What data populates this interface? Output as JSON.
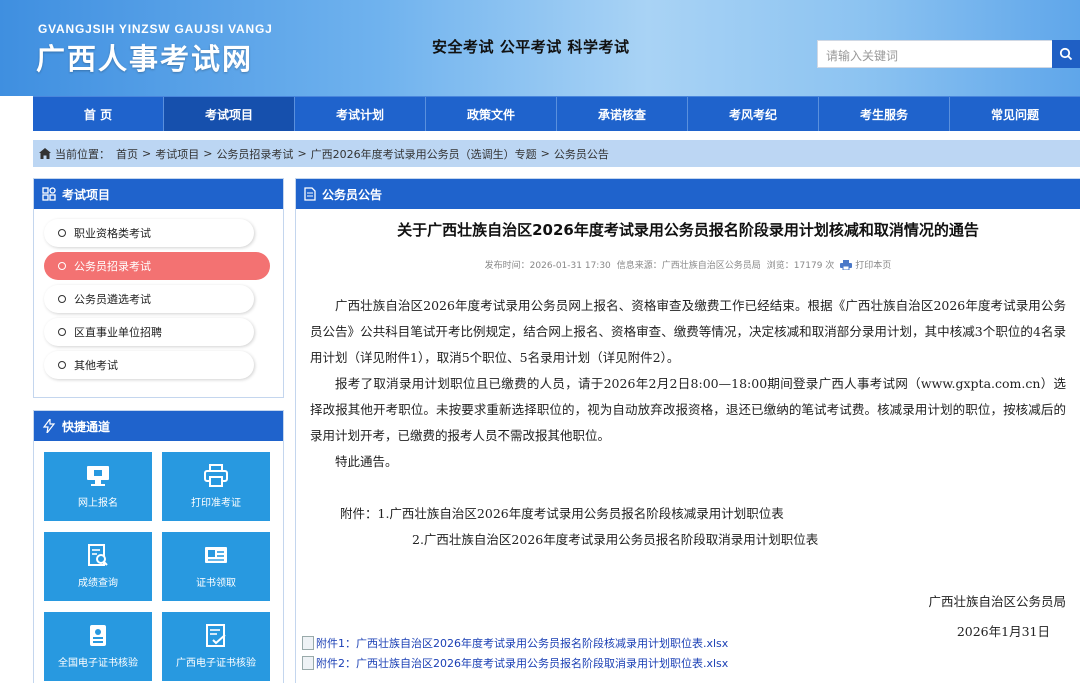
{
  "header": {
    "pinyin": "GVANGJSIH YINZSW GAUJSI VANGJ",
    "site_title": "广西人事考试网",
    "slogan": "安全考试  公平考试  科学考试",
    "search_placeholder": "请输入关键词"
  },
  "nav": {
    "items": [
      "首 页",
      "考试项目",
      "考试计划",
      "政策文件",
      "承诺核查",
      "考风考纪",
      "考生服务",
      "常见问题"
    ],
    "active_index": 1
  },
  "breadcrumb": {
    "prefix": "当前位置：",
    "items": [
      "首页",
      "考试项目",
      "公务员招录考试",
      "广西2026年度考试录用公务员（选调生）专题",
      "公务员公告"
    ],
    "separator": ">"
  },
  "sidebar": {
    "exam_panel_title": "考试项目",
    "exam_items": [
      "职业资格类考试",
      "公务员招录考试",
      "公务员遴选考试",
      "区直事业单位招聘",
      "其他考试"
    ],
    "active_index": 1,
    "quick_panel_title": "快捷通道",
    "quick_links": [
      {
        "label": "网上报名",
        "icon": "computer-icon"
      },
      {
        "label": "打印准考证",
        "icon": "printer-icon"
      },
      {
        "label": "成绩查询",
        "icon": "search-document-icon"
      },
      {
        "label": "证书领取",
        "icon": "certificate-icon"
      },
      {
        "label": "全国电子证书核验",
        "icon": "id-badge-icon"
      },
      {
        "label": "广西电子证书核验",
        "icon": "checklist-icon"
      }
    ]
  },
  "article": {
    "panel_title": "公务员公告",
    "title": "关于广西壮族自治区2026年度考试录用公务员报名阶段录用计划核减和取消情况的通告",
    "meta": {
      "published": "发布时间：2026-01-31 17:30",
      "source": "信息来源：广西壮族自治区公务员局",
      "views": "浏览：17179 次",
      "print_label": "打印本页"
    },
    "paragraphs": [
      "广西壮族自治区2026年度考试录用公务员网上报名、资格审查及缴费工作已经结束。根据《广西壮族自治区2026年度考试录用公务员公告》公共科目笔试开考比例规定，结合网上报名、资格审查、缴费等情况，决定核减和取消部分录用计划，其中核减3个职位的4名录用计划（详见附件1），取消5个职位、5名录用计划（详见附件2）。",
      "报考了取消录用计划职位且已缴费的人员，请于2026年2月2日8:00—18:00期间登录广西人事考试网（www.gxpta.com.cn）选择改报其他开考职位。未按要求重新选择职位的，视为自动放弃改报资格，退还已缴纳的笔试考试费。核减录用计划的职位，按核减后的录用计划开考，已缴费的报考人员不需改报其他职位。",
      "特此通告。"
    ],
    "attachment_1": "附件：1.广西壮族自治区2026年度考试录用公务员报名阶段核减录用计划职位表",
    "attachment_2": "2.广西壮族自治区2026年度考试录用公务员报名阶段取消录用计划职位表",
    "signature": "广西壮族自治区公务员局",
    "date": "2026年1月31日",
    "files": [
      "附件1：广西壮族自治区2026年度考试录用公务员报名阶段核减录用计划职位表.xlsx",
      "附件2：广西壮族自治区2026年度考试录用公务员报名阶段取消录用计划职位表.xlsx"
    ]
  },
  "colors": {
    "nav_blue": "#1f63cc",
    "quick_tile": "#2899e0",
    "active_side": "#f37272",
    "breadcrumb_bg": "#bcd6f3"
  }
}
